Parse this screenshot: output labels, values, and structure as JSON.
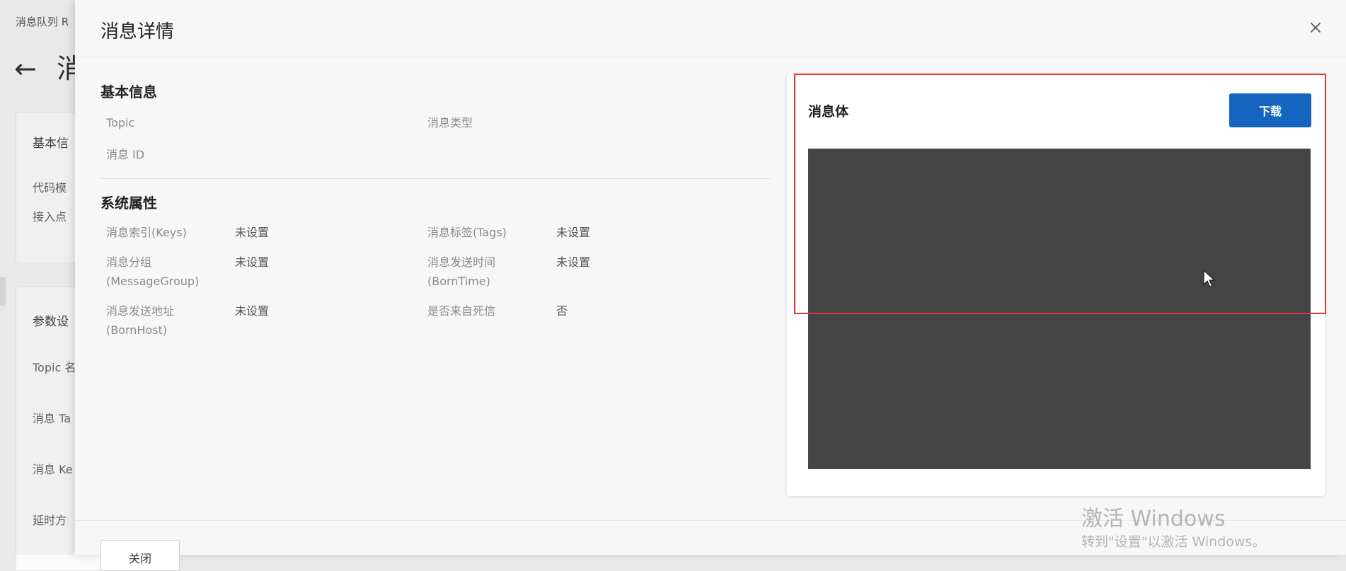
{
  "background": {
    "breadcrumb": "消息队列 R",
    "page_title": "消",
    "card1": {
      "title": "基本信",
      "row1": "代码模",
      "row2": "接入点"
    },
    "card2": {
      "title": "参数设",
      "row1": "Topic 名",
      "row2": "消息 Ta",
      "row3": "消息 Ke",
      "row4": "延时方"
    }
  },
  "drawer": {
    "title": "消息详情",
    "basic": {
      "title": "基本信息",
      "topic_label": "Topic",
      "msg_type_label": "消息类型",
      "msg_id_label": "消息 ID"
    },
    "system": {
      "title": "系统属性",
      "keys_label": "消息索引(Keys)",
      "keys_value": "未设置",
      "tags_label": "消息标签(Tags)",
      "tags_value": "未设置",
      "group_label_1": "消息分组",
      "group_label_2": "(MessageGroup)",
      "group_value": "未设置",
      "borntime_label_1": "消息发送时间",
      "borntime_label_2": "(BornTime)",
      "borntime_value": "未设置",
      "bornhost_label_1": "消息发送地址",
      "bornhost_label_2": "(BornHost)",
      "bornhost_value": "未设置",
      "deadletter_label": "是否来自死信",
      "deadletter_value": "否"
    },
    "message_body": {
      "title": "消息体",
      "download_label": "下载",
      "content": ""
    },
    "footer": {
      "close_label": "关闭"
    }
  },
  "watermark": {
    "title": "激活 Windows",
    "subtitle": "转到\"设置\"以激活 Windows。"
  },
  "colors": {
    "primary": "#1565c0",
    "highlight": "#e53935",
    "body_content_bg": "#444444"
  }
}
